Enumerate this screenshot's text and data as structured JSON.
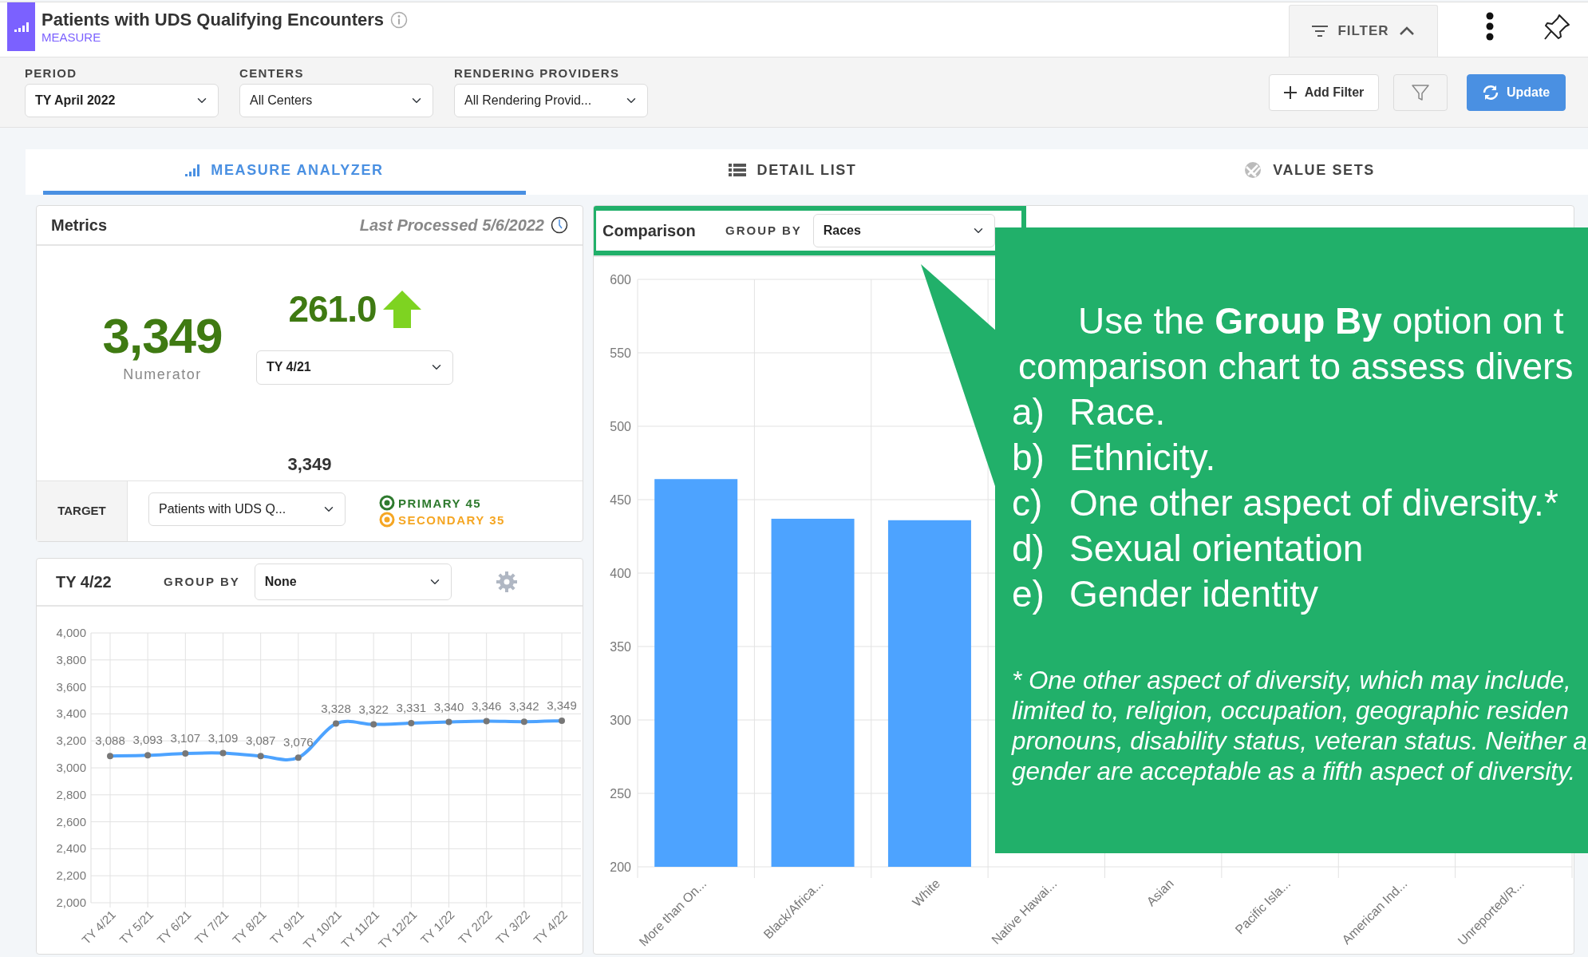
{
  "header": {
    "title": "Patients with UDS Qualifying Encounters",
    "subtitle": "MEASURE",
    "filter_tab": {
      "label": "FILTER",
      "expanded": true
    }
  },
  "filters": [
    {
      "label": "PERIOD",
      "value": "TY April 2022",
      "bold": true
    },
    {
      "label": "CENTERS",
      "value": "All Centers",
      "bold": false
    },
    {
      "label": "RENDERING PROVIDERS",
      "value": "All Rendering Provid...",
      "bold": false
    }
  ],
  "actions": [
    {
      "kind": "add",
      "label": "Add Filter"
    },
    {
      "kind": "funnel"
    },
    {
      "kind": "update",
      "label": "Update"
    }
  ],
  "tabs": [
    {
      "kind": "analyzer",
      "label": "MEASURE ANALYZER",
      "selected": true
    },
    {
      "kind": "list",
      "label": "DETAIL LIST",
      "selected": false
    },
    {
      "kind": "valuesets",
      "label": "VALUE SETS",
      "selected": false
    }
  ],
  "metrics": {
    "title": "Metrics",
    "last_processed": "Last Processed 5/6/2022",
    "numerator": "3,349",
    "numerator_label": "Numerator",
    "change": "261.0",
    "compare_period": "TY 4/21",
    "current_value": "3,349",
    "target_label": "TARGET",
    "target_select": "Patients with UDS Q...",
    "targets": [
      {
        "label": "PRIMARY 45",
        "color": "#2e7a2e"
      },
      {
        "label": "SECONDARY 35",
        "color": "#f5a623"
      }
    ]
  },
  "trend": {
    "title": "TY 4/22",
    "group_by_label": "GROUP BY",
    "group_by": "None",
    "chart_data": {
      "type": "line",
      "grid": true,
      "categories": [
        "TY 4/21",
        "TY 5/21",
        "TY 6/21",
        "TY 7/21",
        "TY 8/21",
        "TY 9/21",
        "TY 10/21",
        "TY 11/21",
        "TY 12/21",
        "TY 1/22",
        "TY 2/22",
        "TY 3/22",
        "TY 4/22"
      ],
      "series": [
        {
          "color": "#4da3ff",
          "marker": "circle",
          "values": [
            3088,
            3093,
            3107,
            3109,
            3087,
            3076,
            3328,
            3322,
            3331,
            3340,
            3346,
            3342,
            3349
          ]
        }
      ],
      "value_labels": [
        "3,088",
        "3,093",
        "3,107",
        "3,109",
        "3,087",
        "3,076",
        "3,328",
        "3,322",
        "3,331",
        "3,340",
        "3,346",
        "3,342",
        "3,349"
      ],
      "ylim": [
        2000,
        4000
      ],
      "yticks": [
        {
          "value": 2000,
          "label": "2,000"
        },
        {
          "value": 2200,
          "label": "2,200"
        },
        {
          "value": 2400,
          "label": "2,400"
        },
        {
          "value": 2600,
          "label": "2,600"
        },
        {
          "value": 2800,
          "label": "2,800"
        },
        {
          "value": 3000,
          "label": "3,000"
        },
        {
          "value": 3200,
          "label": "3,200"
        },
        {
          "value": 3400,
          "label": "3,400"
        },
        {
          "value": 3600,
          "label": "3,600"
        },
        {
          "value": 3800,
          "label": "3,800"
        },
        {
          "value": 4000,
          "label": "4,000"
        }
      ]
    }
  },
  "comparison": {
    "title": "Comparison",
    "group_by_label": "GROUP BY",
    "group_by": "Races",
    "highlighted": true,
    "chart_data": {
      "type": "bar",
      "grid": true,
      "categories": [
        "More than On...",
        "Black/Africa...",
        "White",
        "Native Hawai...",
        "Asian",
        "Pacific Isla...",
        "American Ind...",
        "Unreported/R..."
      ],
      "series": [
        {
          "color": "#4da3ff",
          "values": [
            464,
            437,
            436,
            null,
            null,
            null,
            null,
            null
          ]
        }
      ],
      "ylim": [
        200,
        600
      ],
      "yticks": [
        200,
        250,
        300,
        350,
        400,
        450,
        500,
        550,
        600
      ]
    }
  },
  "callout": {
    "intro_lines": [
      "Use the **Group By** option on t",
      "comparison chart to assess divers"
    ],
    "items": [
      {
        "marker": "a)",
        "text": "Race."
      },
      {
        "marker": "b)",
        "text": "Ethnicity."
      },
      {
        "marker": "c)",
        "text": "One other aspect of diversity.*"
      },
      {
        "marker": "d)",
        "text": "Sexual orientation"
      },
      {
        "marker": "e)",
        "text": "Gender identity"
      }
    ],
    "note_lines": [
      "* One other aspect of diversity, which may include,",
      "limited to, religion, occupation, geographic residen",
      "pronouns, disability status, veteran status. Neither a",
      "gender are acceptable as a fifth aspect of diversity."
    ]
  }
}
